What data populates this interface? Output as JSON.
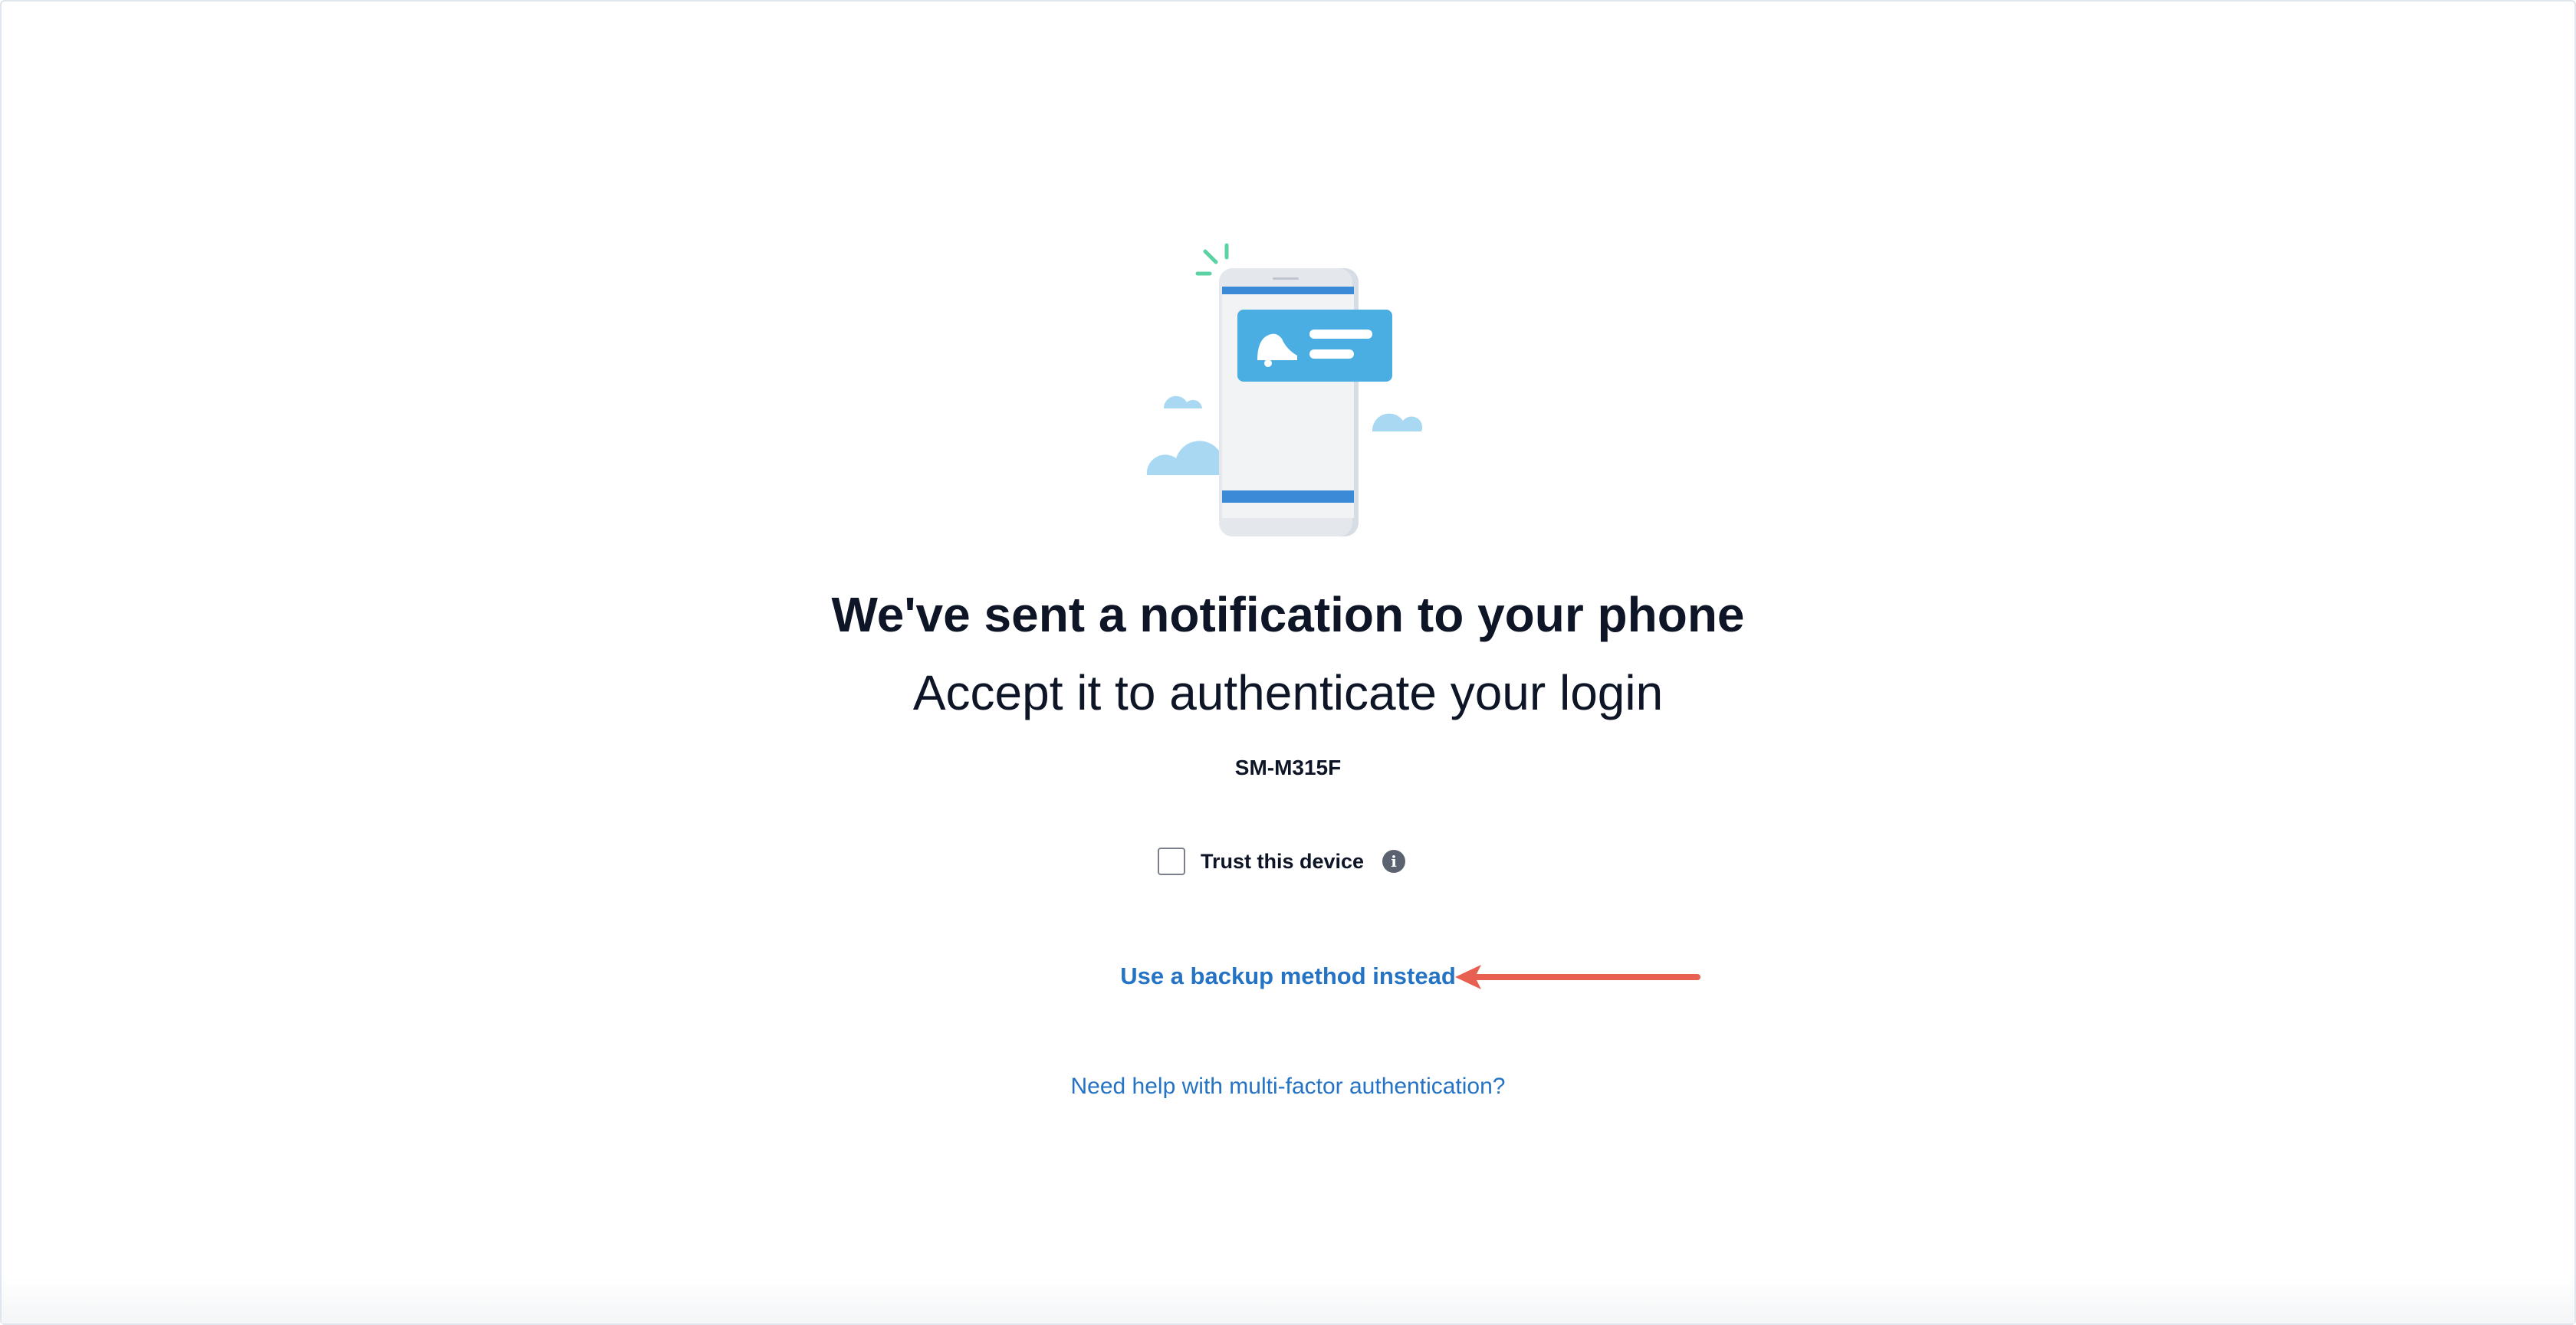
{
  "page": {
    "title": "We've sent a notification to your phone",
    "subtitle": "Accept it to authenticate your login",
    "device_name": "SM-M315F"
  },
  "trust": {
    "label": "Trust this device",
    "checked": false,
    "info_icon": "info-icon"
  },
  "links": {
    "backup": "Use a backup method instead",
    "help": "Need help with multi-factor authentication?"
  },
  "colors": {
    "link": "#2473c4",
    "text": "#0d1526",
    "annotation_arrow": "#e8604f",
    "notification_card": "#4aaee3"
  },
  "icons": {
    "illustration": "phone-notification-illustration",
    "bell": "bell-icon",
    "arrow": "annotation-arrow"
  }
}
